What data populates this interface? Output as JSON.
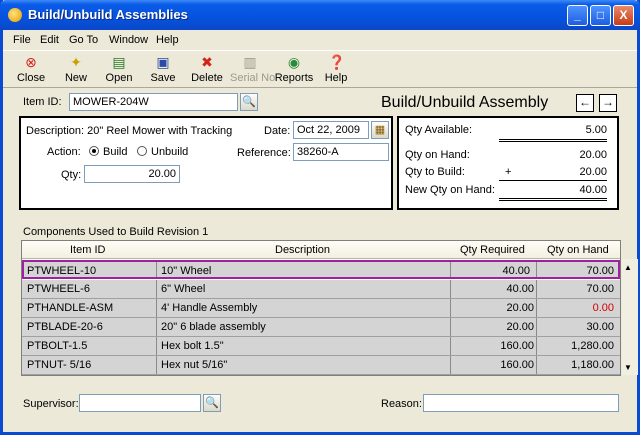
{
  "window": {
    "title": "Build/Unbuild Assemblies",
    "min": "_",
    "max": "□",
    "close": "X"
  },
  "menu": [
    "File",
    "Edit",
    "Go To",
    "Window",
    "Help"
  ],
  "toolbar": {
    "close": "Close",
    "new": "New",
    "open": "Open",
    "save": "Save",
    "delete": "Delete",
    "serial": "Serial No",
    "reports": "Reports",
    "help": "Help"
  },
  "item": {
    "label": "Item ID:",
    "value": "MOWER-204W"
  },
  "heading": "Build/Unbuild Assembly",
  "form": {
    "description": "Description: 20\" Reel Mower with Tracking",
    "action_label": "Action:",
    "action_build": "Build",
    "action_unbuild": "Unbuild",
    "qty_label": "Qty:",
    "qty_value": "20.00",
    "date_label": "Date:",
    "date_value": "Oct 22, 2009",
    "reference_label": "Reference:",
    "reference_value": "38260-A"
  },
  "summary": {
    "qty_available_label": "Qty Available:",
    "qty_available": "5.00",
    "qty_on_hand_label": "Qty on Hand:",
    "qty_on_hand": "20.00",
    "qty_to_build_label": "Qty to Build:",
    "plus": "+",
    "qty_to_build": "20.00",
    "new_qty_label": "New Qty on Hand:",
    "new_qty": "40.00"
  },
  "grid": {
    "caption": "Components Used to Build Revision 1",
    "headers": {
      "item_id": "Item ID",
      "description": "Description",
      "qty_required": "Qty Required",
      "qty_on_hand": "Qty on Hand"
    },
    "rows": [
      {
        "id": "PTWHEEL-10",
        "desc": "10\" Wheel",
        "req": "40.00",
        "onhand": "70.00"
      },
      {
        "id": "PTWHEEL-6",
        "desc": "6\" Wheel",
        "req": "40.00",
        "onhand": "70.00"
      },
      {
        "id": "PTHANDLE-ASM",
        "desc": "4' Handle Assembly",
        "req": "20.00",
        "onhand": "0.00"
      },
      {
        "id": "PTBLADE-20-6",
        "desc": "20\"  6 blade assembly",
        "req": "20.00",
        "onhand": "30.00"
      },
      {
        "id": "PTBOLT-1.5",
        "desc": "Hex bolt 1.5\"",
        "req": "160.00",
        "onhand": "1,280.00"
      },
      {
        "id": "PTNUT- 5/16",
        "desc": "Hex nut 5/16\"",
        "req": "160.00",
        "onhand": "1,180.00"
      }
    ]
  },
  "footer": {
    "supervisor_label": "Supervisor:",
    "supervisor_value": "",
    "reason_label": "Reason:",
    "reason_value": ""
  },
  "colors": {
    "title_blue": "#0652de",
    "selected_row_border": "#a020a0",
    "negative_red": "#d40000"
  }
}
